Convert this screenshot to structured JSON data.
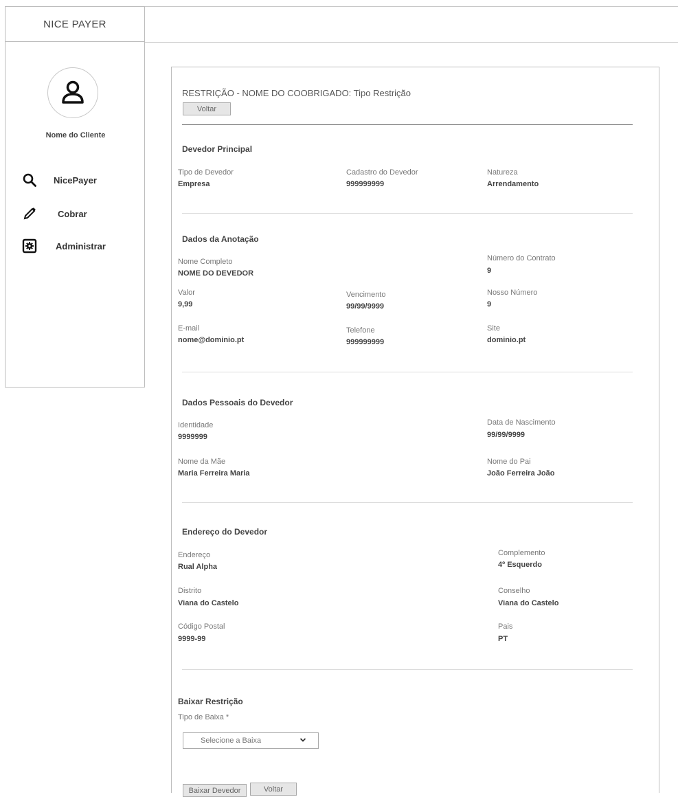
{
  "app": {
    "brand": "NICE PAYER"
  },
  "sidebar": {
    "client_name": "Nome do Cliente",
    "items": [
      {
        "label": "NicePayer",
        "icon": "search-icon"
      },
      {
        "label": "Cobrar",
        "icon": "pencil-icon"
      },
      {
        "label": "Administrar",
        "icon": "gear-box-icon"
      }
    ]
  },
  "page": {
    "title": "RESTRIÇÃO - NOME DO COOBRIGADO: Tipo Restrição",
    "back_button": "Voltar"
  },
  "devedor_principal": {
    "title": "Devedor Principal",
    "fields": [
      {
        "label": "Tipo de Devedor",
        "value": "Empresa"
      },
      {
        "label": "Cadastro do Devedor",
        "value": "999999999"
      },
      {
        "label": "Natureza",
        "value": "Arrendamento"
      }
    ]
  },
  "anotacao": {
    "title": "Dados da Anotação",
    "fields": [
      {
        "label": "Nome Completo",
        "value": "NOME DO DEVEDOR"
      },
      {
        "label": "Número do Contrato",
        "value": "9"
      },
      {
        "label": "Valor",
        "value": "9,99"
      },
      {
        "label": "Vencimento",
        "value": "99/99/9999"
      },
      {
        "label": "Nosso Número",
        "value": "9"
      },
      {
        "label": "E-mail",
        "value": "nome@dominio.pt"
      },
      {
        "label": "Telefone",
        "value": "999999999"
      },
      {
        "label": "Site",
        "value": "dominio.pt"
      }
    ]
  },
  "pessoais": {
    "title": "Dados Pessoais do Devedor",
    "fields": [
      {
        "label": "Identidade",
        "value": "9999999"
      },
      {
        "label": "Data de Nascimento",
        "value": "99/99/9999"
      },
      {
        "label": "Nome da Mãe",
        "value": "Maria Ferreira Maria"
      },
      {
        "label": "Nome do Pai",
        "value": "João Ferreira João"
      }
    ]
  },
  "endereco": {
    "title": "Endereço do Devedor",
    "fields": [
      {
        "label": "Endereço",
        "value": "Rual Alpha"
      },
      {
        "label": "Complemento",
        "value": "4º Esquerdo"
      },
      {
        "label": "Distrito",
        "value": "Viana do Castelo"
      },
      {
        "label": "Conselho",
        "value": "Viana do Castelo"
      },
      {
        "label": "Código Postal",
        "value": "9999-99"
      },
      {
        "label": "Pais",
        "value": "PT"
      }
    ]
  },
  "baixar": {
    "title": "Baixar Restrição",
    "tipo_label": "Tipo de Baixa *",
    "select_placeholder": "Selecione a Baixa",
    "submit_button": "Baixar Devedor",
    "back_button": "Voltar"
  }
}
